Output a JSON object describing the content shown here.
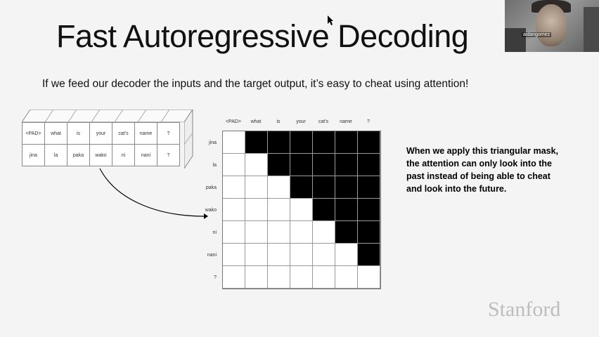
{
  "slide": {
    "title": "Fast Autoregressive Decoding",
    "subtitle": "If we feed our decoder the inputs and the target output, it’s easy to cheat using attention!",
    "note": "When we apply this triangular mask, the attention can only look into the past instead of being able to cheat and look into the future.",
    "watermark": "Stanford"
  },
  "webcam": {
    "label": "aidangomez"
  },
  "token_table": {
    "rows": [
      [
        "<PAD>",
        "what",
        "is",
        "your",
        "cat's",
        "name",
        "?"
      ],
      [
        "jina",
        "la",
        "paka",
        "wako",
        "ni",
        "nani",
        "?"
      ]
    ]
  },
  "matrix": {
    "columns": [
      "<PAD>",
      "what",
      "is",
      "your",
      "cat's",
      "name",
      "?"
    ],
    "rows": [
      "jina",
      "la",
      "paka",
      "wako",
      "ni",
      "nani",
      "?"
    ]
  },
  "colors": {
    "mask": "#000000",
    "grid": "#999999",
    "watermark": "#bdbdbd"
  }
}
